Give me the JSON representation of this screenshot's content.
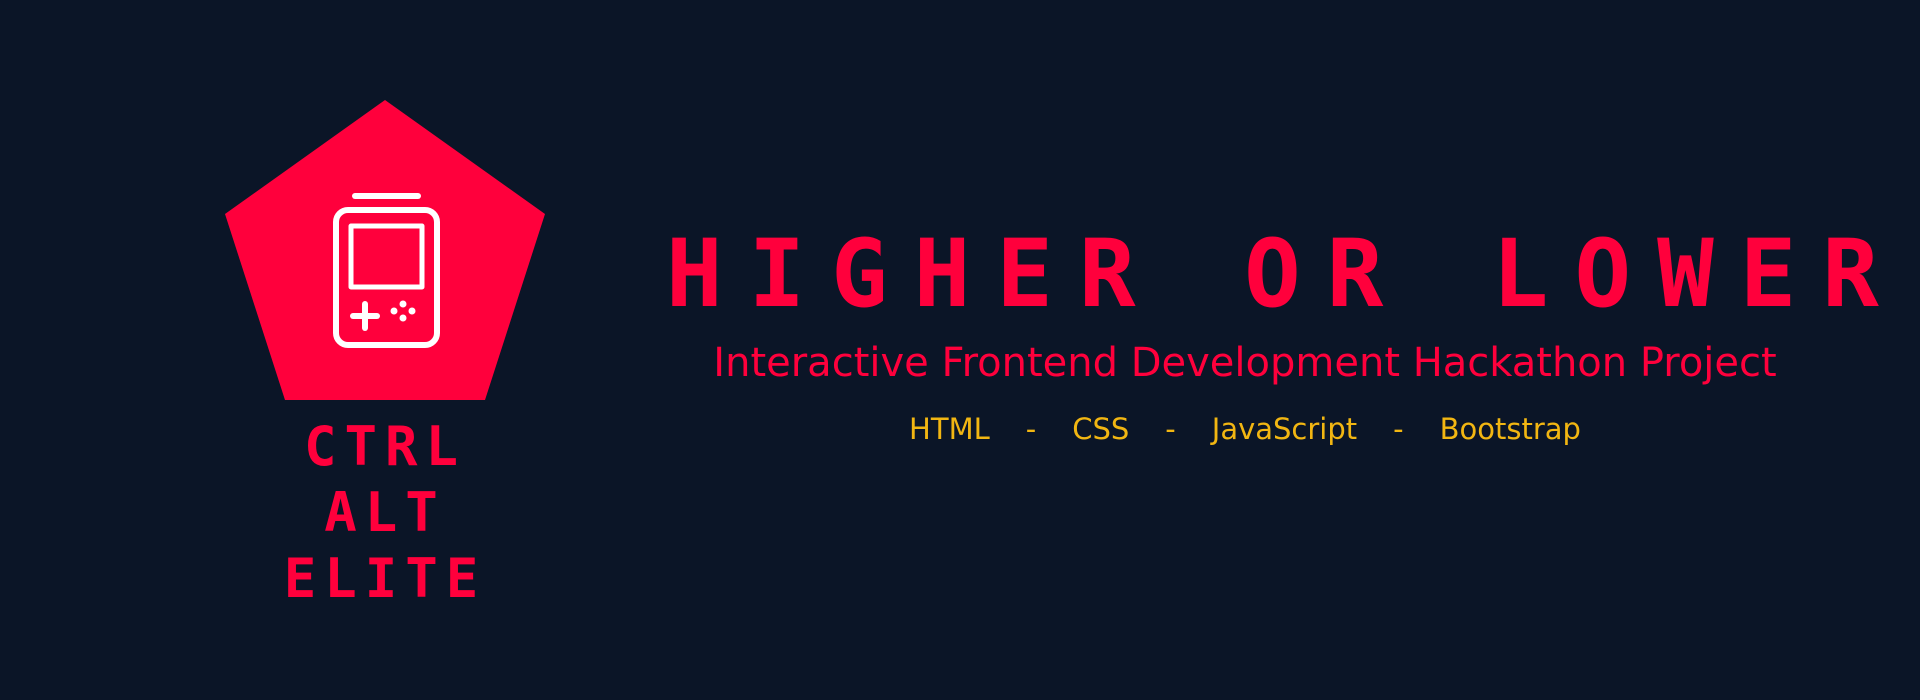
{
  "colors": {
    "background": "#0b1527",
    "accent": "#ff003c",
    "highlight": "#f2b612",
    "icon": "#ffffff"
  },
  "logo": {
    "icon": "handheld-game-console-icon",
    "team_name": [
      "CTRL",
      "ALT",
      "ELITE"
    ]
  },
  "title": "HIGHER OR LOWER",
  "subtitle": "Interactive Frontend Development Hackathon Project",
  "tech_stack": [
    "HTML",
    "CSS",
    "JavaScript",
    "Bootstrap"
  ],
  "separator": "-"
}
